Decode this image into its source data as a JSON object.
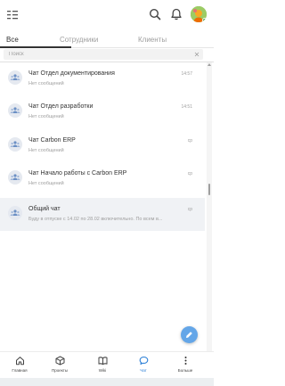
{
  "header": {
    "accent_color": "#2b7fd6",
    "icons": [
      "menu-icon",
      "search-icon",
      "bell-icon",
      "avatar"
    ]
  },
  "tabs": [
    {
      "label": "Все",
      "active": true
    },
    {
      "label": "Сотрудники",
      "active": false
    },
    {
      "label": "Клиенты",
      "active": false
    }
  ],
  "search": {
    "placeholder": "Поиск"
  },
  "chats": [
    {
      "title": "Чат Отдел документирования",
      "subtitle": "Нет сообщений",
      "time": "14:57"
    },
    {
      "title": "Чат Отдел разработки",
      "subtitle": "Нет сообщений",
      "time": "14:51"
    },
    {
      "title": "Чат Carbon ERP",
      "subtitle": "Нет сообщений",
      "time": "ср"
    },
    {
      "title": "Чат Начало работы с Carbon ERP",
      "subtitle": "Нет сообщений",
      "time": "ср"
    },
    {
      "title": "Общий чат",
      "subtitle": "Буду в отпуске с 14.02 по 28.02 включительно. По всем в...",
      "time": "ср"
    }
  ],
  "nav": [
    {
      "label": "Главная",
      "icon": "home-icon",
      "active": false
    },
    {
      "label": "Проекты",
      "icon": "box-icon",
      "active": false
    },
    {
      "label": "Wiki",
      "icon": "book-icon",
      "active": false
    },
    {
      "label": "Чат",
      "icon": "chat-icon",
      "active": true
    },
    {
      "label": "Больше",
      "icon": "more-icon",
      "active": false
    }
  ]
}
